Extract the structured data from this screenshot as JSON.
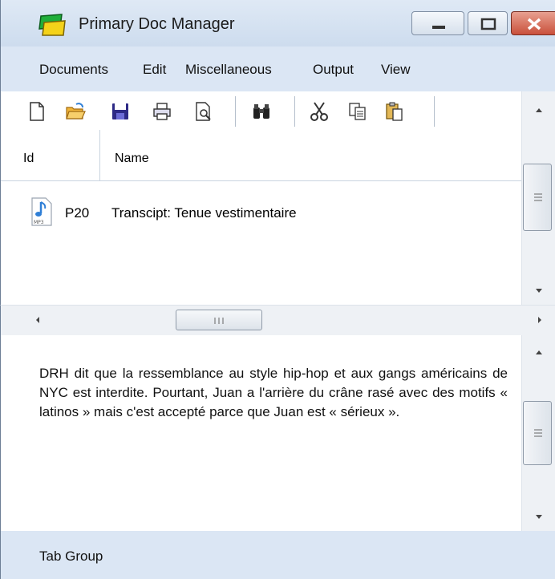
{
  "window": {
    "title": "Primary Doc Manager",
    "icon": "app-folder-icon"
  },
  "menu": {
    "items": [
      "Documents",
      "Edit",
      "Miscellaneous",
      "Output",
      "View"
    ]
  },
  "toolbar": {
    "icons": [
      "new-document-icon",
      "open-folder-icon",
      "save-icon",
      "print-icon",
      "print-preview-icon",
      "find-icon",
      "cut-icon",
      "copy-icon",
      "paste-icon"
    ]
  },
  "table": {
    "columns": [
      "Id",
      "Name"
    ],
    "rows": [
      {
        "icon": "mp3-file-icon",
        "id": "P20",
        "name": "Transcipt: Tenue vestimentaire"
      }
    ]
  },
  "document": {
    "text": "DRH dit que la ressemblance au style hip-hop et aux gangs américains de NYC est interdite. Pourtant, Juan a l'arrière du crâne rasé avec des motifs « latinos » mais c'est accepté parce que Juan est « sérieux »."
  },
  "footer": {
    "tab_group_label": "Tab Group"
  },
  "colors": {
    "titlebar": "#cddcee",
    "menubar": "#dbe6f4",
    "close_button": "#c9503b"
  }
}
